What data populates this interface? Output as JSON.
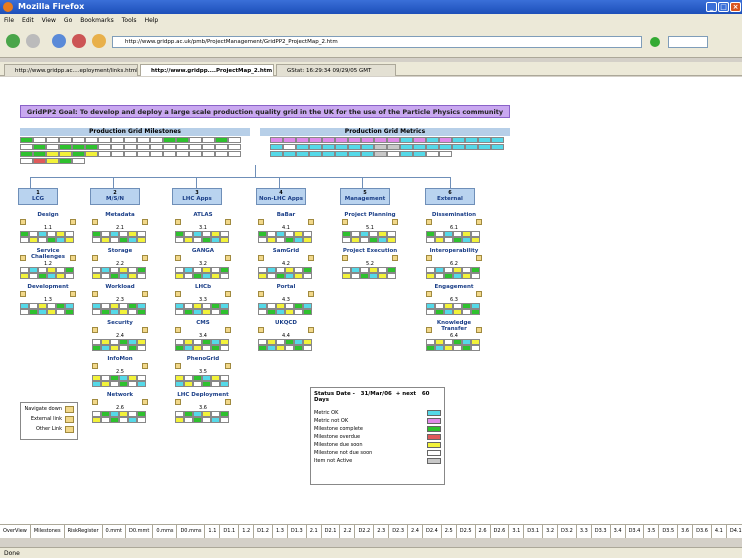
{
  "window": {
    "title": "Mozilla Firefox"
  },
  "menu": [
    "File",
    "Edit",
    "View",
    "Go",
    "Bookmarks",
    "Tools",
    "Help"
  ],
  "url": "http://www.gridpp.ac.uk/pmb/ProjectManagement/GridPP2_ProjectMap_2.htm",
  "tabs": [
    {
      "label": "http://www.gridpp.ac....eployment/links.html"
    },
    {
      "label": "http://www.gridpp....ProjectMap_2.htm"
    },
    {
      "label": "GStat: 16:29:34 09/29/05 GMT"
    }
  ],
  "goal": "GridPP2 Goal: To develop and deploy a large scale production quality grid in the UK for the use of the Particle Physics community",
  "headers": {
    "milestones": "Production Grid Milestones",
    "metrics": "Production Grid Metrics"
  },
  "areas": [
    {
      "num": "1",
      "label": "LCG"
    },
    {
      "num": "2",
      "label": "M/S/N"
    },
    {
      "num": "3",
      "label": "LHC Apps"
    },
    {
      "num": "4",
      "label": "Non-LHC Apps"
    },
    {
      "num": "5",
      "label": "Management"
    },
    {
      "num": "6",
      "label": "External"
    }
  ],
  "projects": {
    "col1": [
      {
        "t": "Design",
        "n": "1.1"
      },
      {
        "t": "Service Challenges",
        "n": "1.2"
      },
      {
        "t": "Development",
        "n": "1.3"
      }
    ],
    "col2": [
      {
        "t": "Metadata",
        "n": "2.1"
      },
      {
        "t": "Storage",
        "n": "2.2"
      },
      {
        "t": "Workload",
        "n": "2.3"
      },
      {
        "t": "Security",
        "n": "2.4"
      },
      {
        "t": "InfoMon",
        "n": "2.5"
      },
      {
        "t": "Network",
        "n": "2.6"
      }
    ],
    "col3": [
      {
        "t": "ATLAS",
        "n": "3.1"
      },
      {
        "t": "GANGA",
        "n": "3.2"
      },
      {
        "t": "LHCb",
        "n": "3.3"
      },
      {
        "t": "CMS",
        "n": "3.4"
      },
      {
        "t": "PhenoGrid",
        "n": "3.5"
      },
      {
        "t": "LHC Deployment",
        "n": "3.6"
      }
    ],
    "col4": [
      {
        "t": "BaBar",
        "n": "4.1"
      },
      {
        "t": "SamGrid",
        "n": "4.2"
      },
      {
        "t": "Portal",
        "n": "4.3"
      },
      {
        "t": "UKQCD",
        "n": "4.4"
      }
    ],
    "col5": [
      {
        "t": "Project Planning",
        "n": "5.1"
      },
      {
        "t": "Project Execution",
        "n": "5.2"
      }
    ],
    "col6": [
      {
        "t": "Dissemination",
        "n": "6.1"
      },
      {
        "t": "Interoperability",
        "n": "6.2"
      },
      {
        "t": "Engagement",
        "n": "6.3"
      },
      {
        "t": "Knowledge Transfer",
        "n": "6.4"
      }
    ]
  },
  "navigate": {
    "down": "Navigate down",
    "external": "External link",
    "other": "Other Link"
  },
  "status": {
    "date_label": "Status Date -",
    "date": "31/Mar/06",
    "next_label": "+ next",
    "days": "60",
    "days_label": "Days",
    "legend": [
      {
        "label": "Metric OK",
        "color": "#55d9e8"
      },
      {
        "label": "Metric not OK",
        "color": "#e08ae8"
      },
      {
        "label": "Milestone complete",
        "color": "#2ec12e"
      },
      {
        "label": "Milestone overdue",
        "color": "#e05a5a"
      },
      {
        "label": "Milestone due soon",
        "color": "#f2f23a"
      },
      {
        "label": "Milestone not due soon",
        "color": "#ffffff"
      },
      {
        "label": "Item not Active",
        "color": "#c8c8c8"
      }
    ]
  },
  "sheet_tabs": [
    "OverView",
    "Milestones",
    "RiskRegister",
    "0.mmt",
    "D0.mmt",
    "0.mms",
    "D0.mms",
    "1.1",
    "D1.1",
    "1.2",
    "D1.2",
    "1.3",
    "D1.3",
    "2.1",
    "D2.1",
    "2.2",
    "D2.2",
    "2.3",
    "D2.3",
    "2.4",
    "D2.4",
    "2.5",
    "D2.5",
    "2.6",
    "D2.6",
    "3.1",
    "D3.1",
    "3.2",
    "D3.2",
    "3.3",
    "D3.3",
    "3.4",
    "D3.4",
    "3.5",
    "D3.5",
    "3.6",
    "D3.6",
    "4.1",
    "D4.1",
    "4.2"
  ],
  "statusbar": "Done"
}
